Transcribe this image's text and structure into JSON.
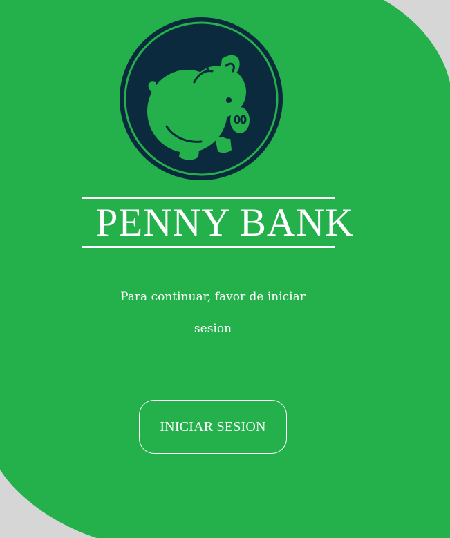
{
  "colors": {
    "background": "#d6d6d6",
    "brand_green": "#24b14c",
    "logo_navy": "#0c2a3d",
    "text": "#ffffff"
  },
  "logo": {
    "icon": "piggy-bank-icon"
  },
  "brand": {
    "name": "PENNY BANK"
  },
  "message": {
    "line1": "Para continuar, favor de iniciar",
    "line2": "sesion"
  },
  "login": {
    "button_label": "INICIAR SESION"
  }
}
